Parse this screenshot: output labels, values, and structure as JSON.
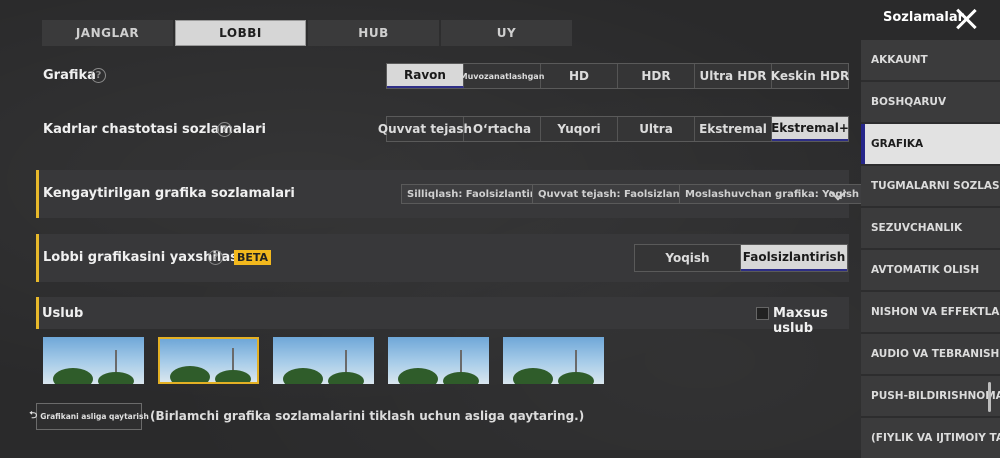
{
  "tabs": [
    "JANGLAR",
    "LOBBI",
    "HUB",
    "UY"
  ],
  "grafika": {
    "label": "Grafika",
    "options": [
      "Ravon",
      "Muvozanatlashgan",
      "HD",
      "HDR",
      "Ultra HDR",
      "Keskin HDR"
    ],
    "selected": "Ravon"
  },
  "fps": {
    "label": "Kadrlar chastotasi sozlamalari",
    "options": [
      "Quvvat tejash",
      "O‘rtacha",
      "Yuqori",
      "Ultra",
      "Ekstremal",
      "Ekstremal+"
    ],
    "selected": "Ekstremal+"
  },
  "advanced": {
    "label": "Kengaytirilgan grafika sozlamalari",
    "chips": [
      "Silliqlash: Faolsizlantirish",
      "Quvvat tejash: Faolsizlantirish",
      "Moslashuvchan grafika: Yoqish"
    ]
  },
  "lobby": {
    "label": "Lobbi grafikasini yaxshilash",
    "badge": "BETA",
    "options": [
      "Yoqish",
      "Faolsizlantirish"
    ],
    "selected": "Faolsizlantirish"
  },
  "style": {
    "label": "Uslub",
    "custom_label": "Maxsus uslub",
    "selected_index": 1,
    "thumb_count": 5
  },
  "reset": {
    "button_label": "Grafikani asliga qaytarish",
    "note": "(Birlamchi grafika sozlamalarini tiklash uchun asliga qaytaring.)"
  },
  "sidebar": {
    "title": "Sozlamalar",
    "items": [
      {
        "label": "AKKAUNT"
      },
      {
        "label": "BOSHQARUV"
      },
      {
        "label": "GRAFIKA"
      },
      {
        "label": "TUGMALARNI SOZLASH"
      },
      {
        "label": "SEZUVCHANLIK"
      },
      {
        "label": "AVTOMATIK OLISH"
      },
      {
        "label": "NISHON VA EFFEKTLAR"
      },
      {
        "label": "AUDIO VA TEBRANISH"
      },
      {
        "label": "PUSH-BILDIRISHNOMALAR"
      },
      {
        "label": "(FIYLIK VA IJTIMOIY TARMO"
      }
    ],
    "selected": "GRAFIKA"
  },
  "colors": {
    "accent": "#e8b92b",
    "selected_bg": "#d8d8d8",
    "selected_underline": "#2e2e86"
  },
  "icons": {
    "help": "question-circle-icon",
    "close": "close-icon",
    "expand": "chevron-down-icon",
    "reset": "undo-arrow-icon"
  }
}
